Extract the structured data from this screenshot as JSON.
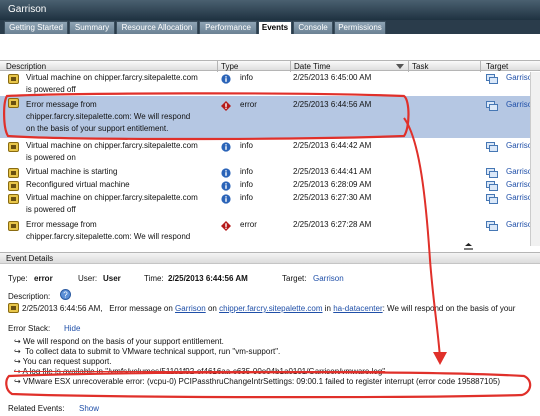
{
  "window": {
    "title": "Garrison"
  },
  "tabs": [
    {
      "label": "Getting Started"
    },
    {
      "label": "Summary"
    },
    {
      "label": "Resource Allocation"
    },
    {
      "label": "Performance"
    },
    {
      "label": "Events"
    },
    {
      "label": "Console"
    },
    {
      "label": "Permissions"
    }
  ],
  "columns": {
    "description": "Description",
    "type": "Type",
    "datetime": "Date Time",
    "task": "Task",
    "target": "Target"
  },
  "events": [
    {
      "line1": "Virtual machine on chipper.farcry.sitepalette.com",
      "line2": "is powered off",
      "type": "info",
      "datetime": "2/25/2013 6:45:00 AM",
      "target": "Garrison"
    },
    {
      "line1": "Error message from",
      "line2": "chipper.farcry.sitepalette.com: We will respond",
      "line3": "on the basis of your support entitlement.",
      "type": "error",
      "datetime": "2/25/2013 6:44:56 AM",
      "target": "Garrison"
    },
    {
      "line1": "Virtual machine on chipper.farcry.sitepalette.com",
      "line2": "is powered on",
      "type": "info",
      "datetime": "2/25/2013 6:44:42 AM",
      "target": "Garrison"
    },
    {
      "line1": "Virtual machine is starting",
      "type": "info",
      "datetime": "2/25/2013 6:44:41 AM",
      "target": "Garrison"
    },
    {
      "line1": "Reconfigured virtual machine",
      "type": "info",
      "datetime": "2/25/2013 6:28:09 AM",
      "target": "Garrison"
    },
    {
      "line1": "Virtual machine on chipper.farcry.sitepalette.com",
      "line2": "is powered off",
      "type": "info",
      "datetime": "2/25/2013 6:27:30 AM",
      "target": "Garrison"
    },
    {
      "line1": "Error message from",
      "line2": "chipper.farcry.sitepalette.com: We will respond",
      "type": "error",
      "datetime": "2/25/2013 6:27:28 AM",
      "target": "Garrison"
    }
  ],
  "details": {
    "header": "Event Details",
    "type_label": "Type:",
    "type_value": "error",
    "user_label": "User:",
    "user_value": "User",
    "time_label": "Time:",
    "time_value": "2/25/2013 6:44:56 AM",
    "target_label": "Target:",
    "target_value": "Garrison",
    "description_label": "Description:",
    "desc_time": "2/25/2013 6:44:56 AM,",
    "desc_text1": "Error message on",
    "desc_link1": "Garrison",
    "desc_text2": "on",
    "desc_link2": "chipper.farcry.sitepalette.com",
    "desc_text3": "in",
    "desc_link3": "ha-datacenter",
    "desc_text4": ": We will respond on the basis of your",
    "error_stack_label": "Error Stack:",
    "hide_label": "Hide",
    "stack": [
      "We will respond on the basis of your support entitlement.",
      "To collect data to submit to VMware technical support, run \"vm-support\".",
      "You can request support.",
      "A log file is available in \"/vmfs/volumes/51101f92-ef4616aa-c635-00e04b1a0101/Garrison/vmware.log\"",
      "VMware ESX unrecoverable error: (vcpu-0) PCIPassthruChangeIntrSettings: 09:00.1 failed to register interrupt (error code 195887105)"
    ],
    "related_label": "Related Events:",
    "show_label": "Show"
  },
  "colors": {
    "annotation": "#e0302a",
    "selected_row": "#b5c7e3",
    "link": "#1f4fa8",
    "error_icon": "#b51a1a",
    "info_icon": "#2b64b8"
  }
}
